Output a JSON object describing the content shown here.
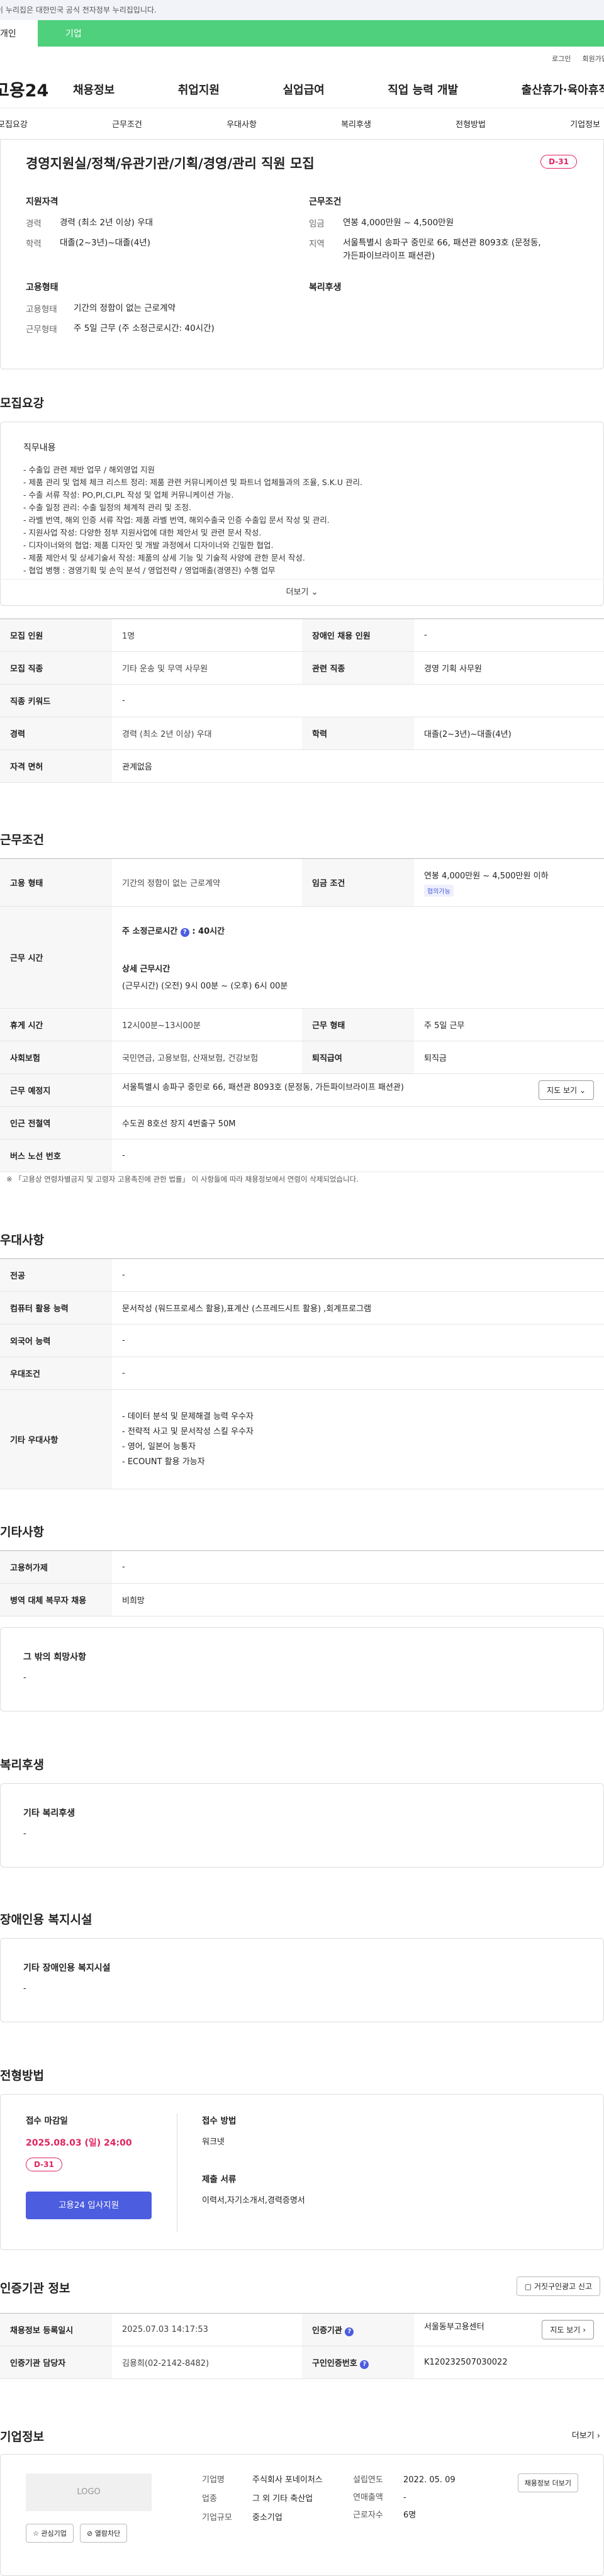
{
  "gov_banner": "이 누리집은 대한민국 공식 전자정부 누리집입니다.",
  "user_tabs": {
    "personal": "개인",
    "business": "기업"
  },
  "util": {
    "login": "로그인",
    "join": "회원가입"
  },
  "logo": "고용24",
  "gnb": [
    "채용정보",
    "취업지원",
    "실업급여",
    "직업 능력 개발",
    "출산휴가·육아휴직"
  ],
  "subtabs": [
    "모집요강",
    "근무조건",
    "우대사항",
    "복리후생",
    "전형방법",
    "기업정보"
  ],
  "summary": {
    "title": "경영지원실/정책/유관기관/기획/경영/관리 직원 모집",
    "dday": "D-31",
    "qual_head": "지원자격",
    "career_k": "경력",
    "career_v": "경력 (최소 2년 이상) 우대",
    "edu_k": "학력",
    "edu_v": "대졸(2~3년)~대졸(4년)",
    "work_head": "근무조건",
    "wage_k": "임금",
    "wage_v": "연봉 4,000만원 ~ 4,500만원",
    "area_k": "지역",
    "area_v": "서울특별시 송파구 중민로 66, 패션관 8093호 (문정동, 가든파이브라이프 패션관)",
    "emp_head": "고용형태",
    "emptype_k": "고용형태",
    "emptype_v": "기간의 정함이 없는 근로계약",
    "worktype_k": "근무형태",
    "worktype_v": "주 5일 근무 (주 소정근로시간: 40시간)",
    "welfare_head": "복리후생"
  },
  "recruit": {
    "title": "모집요강",
    "job_head": "직무내용",
    "lines": [
      "- 수출입 관련 제반 업무 / 해외영업 지원",
      "- 제품 관리 및 업체 체크 리스트 정리: 제품 관련 커뮤니케이션 및 파트너 업체들과의 조율, S.K.U 관리.",
      "- 수출 서류 작성: PO,PI,CI,PL 작성 및 업체 커뮤니케이션 가능.",
      "- 수출 일정 관리: 수출 일정의 체계적 관리 및 조정.",
      "- 라벨 번역, 해외 인증 서류 작업: 제품 라벨 번역, 해외수출국 인증 수출입 문서 작성 및 관리.",
      "- 지원사업 작성: 다양한 정부 지원사업에 대한 제안서 및 관련 문서 작성.",
      "- 디자이너와의 협업: 제품 디자인 및 개발 과정에서 디자이너와 긴밀한 협업.",
      "- 제품 제안서 및 상세기술서 작성: 제품의 상세 기능 및 기술적 사양에 관한 문서 작성.",
      "- 협업 병행 : 경영기획 및 손익 분석 / 영업전략 / 영업매출(경영진) 수행 업무"
    ],
    "more": "더보기",
    "rows": [
      [
        "모집 인원",
        "1명",
        "장애인 채용 인원",
        "-"
      ],
      [
        "모집 직종",
        "기타 운송 및 무역 사무원",
        "관련 직종",
        "경영 기획 사무원"
      ],
      [
        "직종 키워드",
        "-",
        "",
        ""
      ],
      [
        "경력",
        "경력 (최소 2년 이상) 우대",
        "학력",
        "대졸(2~3년)~대졸(4년)"
      ],
      [
        "자격 면허",
        "관계없음",
        "",
        ""
      ]
    ]
  },
  "work": {
    "title": "근무조건",
    "emp_h": "고용 형태",
    "emp_v": "기간의 정함이 없는 근로계약",
    "wage_h": "임금 조건",
    "wage_v": "연봉 4,000만원 ~ 4,500만원 이하",
    "wage_tag": "협의가능",
    "time_h": "근무 시간",
    "time_line1": "주 소정근로시간",
    "time_line1b": ": 40시간",
    "time_line2": "상세 근무시간",
    "time_line3": "(근무시간) (오전) 9시 00분 ~ (오후) 6시 00분",
    "rest_h": "휴게 시간",
    "rest_v": "12시00분~13시00분",
    "form_h": "근무 형태",
    "form_v": "주 5일 근무",
    "ins_h": "사회보험",
    "ins_v": "국민연금, 고용보험, 산재보험, 건강보험",
    "ret_h": "퇴직급여",
    "ret_v": "퇴직금",
    "loc_h": "근무 예정지",
    "loc_v": "서울특별시 송파구 중민로 66, 패션관 8093호 (문정동, 가든파이브라이프 패션관)",
    "map_btn": "지도 보기",
    "sub_h": "인근 전철역",
    "sub_v": "수도권 8호선 장지 4번출구 50M",
    "bus_h": "버스 노선 번호",
    "bus_v": "-",
    "note": "※ 「고용상 연령차별금지 및 고령자 고용촉진에 관한 법률」 이 사항들에 따라 채용정보에서 연령이 삭제되었습니다."
  },
  "pref": {
    "title": "우대사항",
    "major_h": "전공",
    "major_v": "-",
    "pc_h": "컴퓨터 활용 능력",
    "pc_v": "문서작성 (워드프로세스 활용),표계산 (스프레드시트 활용) ,회계프로그램",
    "lang_h": "외국어 능력",
    "lang_v": "-",
    "cond_h": "우대조건",
    "cond_v": "-",
    "etc_h": "기타 우대사항",
    "etc_lines": [
      "- 데이터 분석 및 문제해결 능력 우수자",
      "- 전략적 사고 및 문서작성 스킬 우수자",
      "- 영어, 일본어 능통자",
      "- ECOUNT 활용 가능자"
    ]
  },
  "etc": {
    "title": "기타사항",
    "contract_h": "고용허가제",
    "contract_v": "-",
    "military_h": "병역 대체 복무자 채용",
    "military_v": "비희망",
    "other_lbl": "그 밖의 희망사항",
    "other_v": "-"
  },
  "welfare": {
    "title": "복리후생",
    "lbl": "기타 복리후생",
    "v": "-"
  },
  "disability": {
    "title": "장애인용 복지시설",
    "lbl": "기타 장애인용 복지시설",
    "v": "-"
  },
  "apply": {
    "title": "전형방법",
    "deadline_lbl": "접수 마감일",
    "deadline_v": "2025.08.03 (일) 24:00",
    "dday": "D-31",
    "apply_btn": "고용24 입사지원",
    "method_lbl": "접수 방법",
    "method_v": "워크넷",
    "docs_lbl": "제출 서류",
    "docs_v": "이력서,자기소개서,경력증명서"
  },
  "cert": {
    "title": "인증기관 정보",
    "report_btn": "거짓구인광고 신고",
    "reg_h": "채용정보 등록일시",
    "reg_v": "2025.07.03 14:17:53",
    "org_h": "인증기관",
    "org_v": "서울동부고용센터",
    "map_btn": "지도 보기",
    "mgr_h": "인증기관 담당자",
    "mgr_v": "김용희(02-2142-8482)",
    "num_h": "구인인증번호",
    "num_v": "K120232507030022"
  },
  "company": {
    "title": "기업정보",
    "more": "더보기",
    "logo": "LOGO",
    "fav_btn": "관심기업",
    "block_btn": "열람차단",
    "name_k": "기업명",
    "name_v": "주식회사 포네이처스",
    "ind_k": "업종",
    "ind_v": "그 외 기타 축산업",
    "size_k": "기업규모",
    "size_v": "중소기업",
    "est_k": "설립연도",
    "est_v": "2022. 05. 09",
    "sales_k": "연매출액",
    "sales_v": "-",
    "emp_k": "근로자수",
    "emp_v": "6명",
    "jobs_btn": "채용정보 더보기"
  }
}
